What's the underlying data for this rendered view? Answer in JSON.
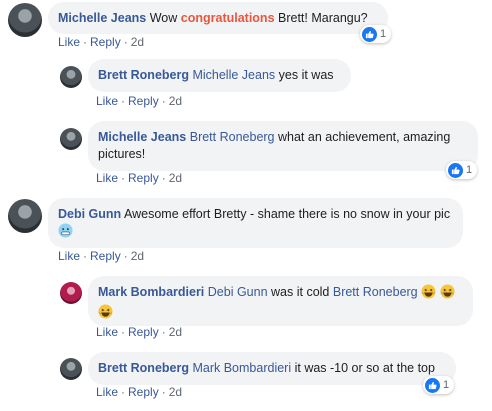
{
  "actions": {
    "like": "Like",
    "reply": "Reply",
    "separator": "·"
  },
  "colors": {
    "link": "#385898",
    "bubble": "#f2f3f5",
    "highlight": "#e9563c",
    "like_blue": "#1877f2"
  },
  "comments": [
    {
      "author": "Michelle Jeans",
      "text_before": "Wow ",
      "highlight": "congratulations",
      "text_after": " Brett! Marangu?",
      "time": "2d",
      "reactions": "1",
      "reaction_icon": "like-icon"
    },
    {
      "author": "Brett Roneberg",
      "mention": "Michelle Jeans",
      "text": "yes it was",
      "time": "2d"
    },
    {
      "author": "Michelle Jeans",
      "mention": "Brett Roneberg",
      "text": "what an achievement, amazing pictures!",
      "time": "2d",
      "reactions": "1",
      "reaction_icon": "like-icon"
    },
    {
      "author": "Debi Gunn",
      "text": "Awesome effort Bretty - shame there is no snow in your pic",
      "emoji": "cold-face-emoji",
      "time": "2d"
    },
    {
      "author": "Mark Bombardieri",
      "mention": "Debi Gunn",
      "text": "was it cold",
      "mention2": "Brett Roneberg",
      "emoji": "laughing-emoji",
      "time": "2d"
    },
    {
      "author": "Brett Roneberg",
      "mention": "Mark Bombardieri",
      "text": "it was -10 or so at the top",
      "time": "2d",
      "reactions": "1",
      "reaction_icon": "like-icon"
    }
  ]
}
